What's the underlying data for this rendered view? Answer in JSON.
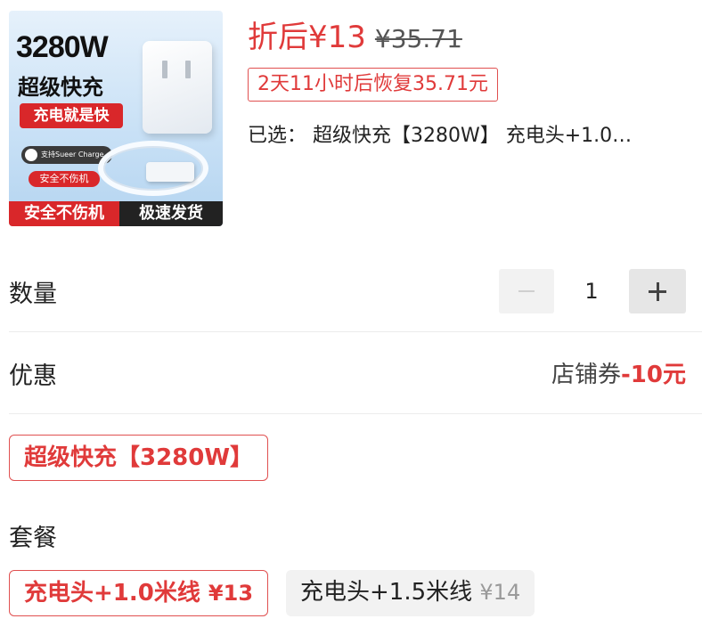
{
  "product_image": {
    "watt": "3280W",
    "headline": "超级快充",
    "red_tag": "充电就是快",
    "support_badge": "支持Sueer Charge",
    "safe_small": "安全不伤机",
    "bottom_left": "安全不伤机",
    "bottom_right": "极速发货"
  },
  "price": {
    "current": "折后¥13",
    "original": "¥35.71",
    "restore_notice": "2天11小时后恢复35.71元",
    "selected_text": "已选：  超级快充【3280W】 充电头+1.0…"
  },
  "quantity": {
    "label": "数量",
    "value": "1"
  },
  "discount": {
    "label": "优惠",
    "coupon_label": "店铺券",
    "coupon_value": "-10元"
  },
  "spec": {
    "option": "超级快充【3280W】"
  },
  "package": {
    "label": "套餐",
    "options": [
      {
        "name": "充电头+1.0米线",
        "price": "¥13",
        "selected": true
      },
      {
        "name": "充电头+1.5米线",
        "price": "¥14",
        "selected": false
      }
    ]
  },
  "colors": {
    "accent_red": "#e03a3a",
    "chip_gray": "#f2f2f2"
  }
}
